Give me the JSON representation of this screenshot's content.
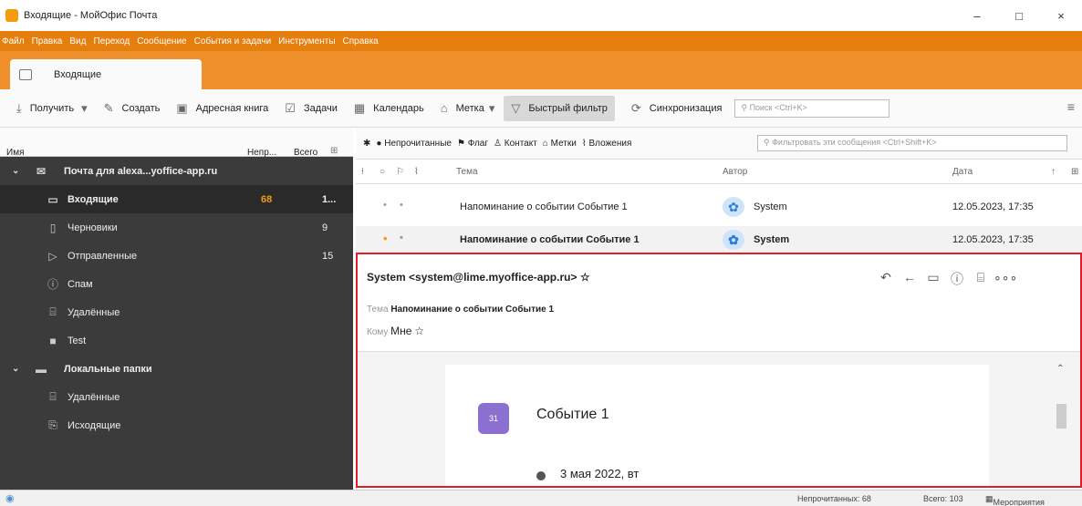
{
  "window": {
    "title": "Входящие - МойОфис Почта",
    "minimize": "–",
    "maximize": "□",
    "close": "×"
  },
  "menu": [
    "Файл",
    "Правка",
    "Вид",
    "Переход",
    "Сообщение",
    "События и задачи",
    "Инструменты",
    "Справка"
  ],
  "tab": {
    "label": "Входящие"
  },
  "toolbar": {
    "get": "Получить",
    "create": "Создать",
    "addressbook": "Адресная книга",
    "tasks": "Задачи",
    "calendar": "Календарь",
    "tag": "Метка",
    "quickfilter": "Быстрый фильтр",
    "sync": "Синхронизация",
    "search_placeholder": "Поиск <Ctrl+K>"
  },
  "sidebar": {
    "col_name": "Имя",
    "col_unread": "Непр...",
    "col_total": "Всего",
    "account": "Почта для alexa...yoffice-app.ru",
    "folders": [
      {
        "label": "Входящие",
        "unread": "68",
        "total": "1..."
      },
      {
        "label": "Черновики",
        "unread": "",
        "total": "9"
      },
      {
        "label": "Отправленные",
        "unread": "",
        "total": "15"
      },
      {
        "label": "Спам",
        "unread": "",
        "total": ""
      },
      {
        "label": "Удалённые",
        "unread": "",
        "total": ""
      },
      {
        "label": "Test",
        "unread": "",
        "total": ""
      }
    ],
    "local": "Локальные папки",
    "local_folders": [
      {
        "label": "Удалённые"
      },
      {
        "label": "Исходящие"
      }
    ]
  },
  "filterbar": {
    "unread": "Непрочитанные",
    "flag": "Флаг",
    "contact": "Контакт",
    "tags": "Метки",
    "attachments": "Вложения",
    "search_placeholder": "Фильтровать эти сообщения <Ctrl+Shift+K>"
  },
  "columns": {
    "subject": "Тема",
    "author": "Автор",
    "date": "Дата"
  },
  "messages": [
    {
      "subject": "Напоминание о событии Событие 1",
      "author": "System",
      "date": "12.05.2023, 17:35"
    },
    {
      "subject": "Напоминание о событии Событие 1",
      "author": "System",
      "date": "12.05.2023, 17:35"
    }
  ],
  "preview": {
    "from": "System <system@lime.myoffice-app.ru>",
    "subject_label": "Тема",
    "subject": "Напоминание о событии Событие 1",
    "to_label": "Кому",
    "to": "Мне",
    "event_icon_num": "31",
    "event_title": "Событие 1",
    "event_date": "3 мая 2022, вт"
  },
  "status": {
    "unread": "Непрочитанных: 68",
    "total": "Всего: 103",
    "events": "Мероприятия"
  }
}
